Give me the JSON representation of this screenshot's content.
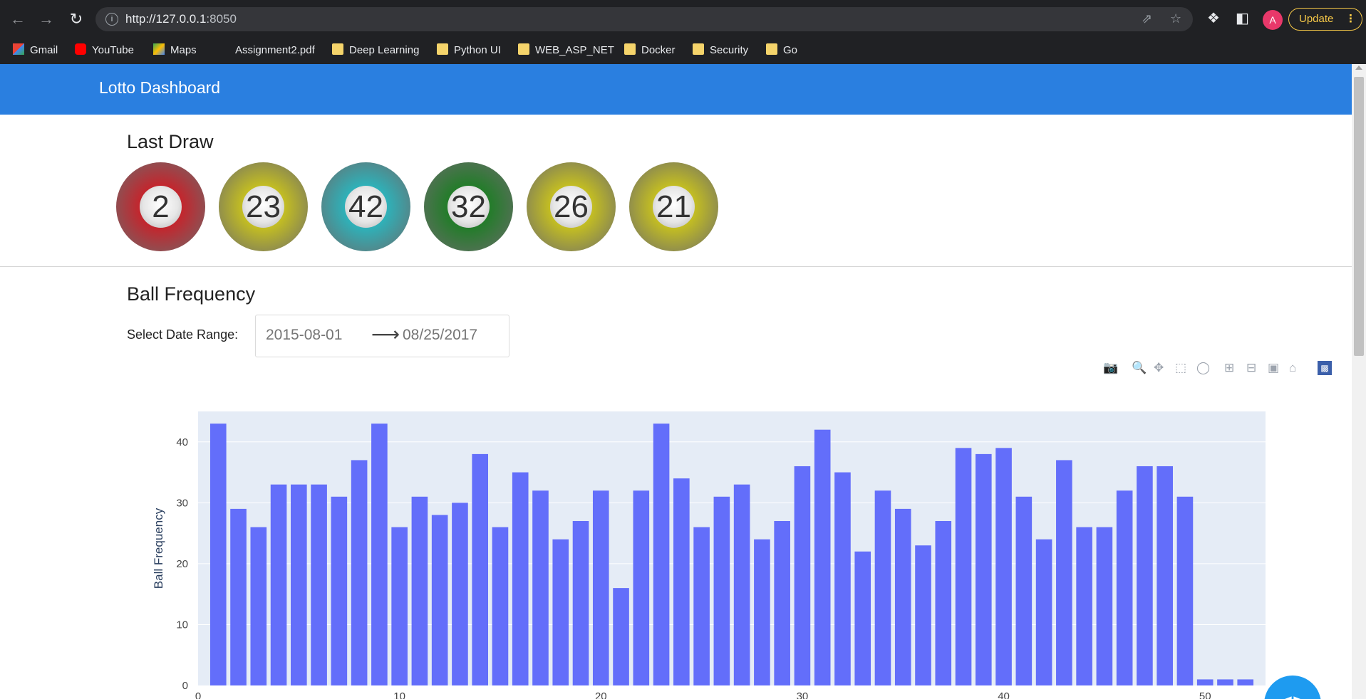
{
  "browser": {
    "url_host": "http://127.0.0.1",
    "url_port": ":8050",
    "avatar_letter": "A",
    "update_label": "Update",
    "bookmarks": [
      "Gmail",
      "YouTube",
      "Maps",
      "Assignment2.pdf",
      "Deep Learning",
      "Python UI",
      "WEB_ASP_NET",
      "Docker",
      "Security",
      "Go"
    ]
  },
  "app": {
    "brand": "Lotto Dashboard",
    "last_draw_title": "Last Draw",
    "balls": [
      {
        "number": "2",
        "color": "#c8222a"
      },
      {
        "number": "23",
        "color": "#c8c21e"
      },
      {
        "number": "42",
        "color": "#2bb5bd"
      },
      {
        "number": "32",
        "color": "#1f7d26"
      },
      {
        "number": "26",
        "color": "#c8c21e"
      },
      {
        "number": "21",
        "color": "#c8c21e"
      }
    ],
    "frequency_title": "Ball Frequency",
    "date_range_label": "Select Date Range:",
    "start_date": "2015-08-01",
    "end_date": "08/25/2017",
    "modebar_icons": [
      "camera-icon",
      "zoom-icon",
      "pan-icon",
      "box-select-icon",
      "lasso-icon",
      "zoom-in-icon",
      "zoom-out-icon",
      "autoscale-icon",
      "reset-axes-icon",
      "plotly-logo-icon"
    ]
  },
  "chart_data": {
    "type": "bar",
    "ylabel": "Ball Frequency",
    "xlabel": "",
    "xlim": [
      0,
      53
    ],
    "ylim": [
      0,
      45
    ],
    "xticks": [
      0,
      10,
      20,
      30,
      40,
      50
    ],
    "yticks": [
      0,
      10,
      20,
      30,
      40
    ],
    "x": [
      1,
      2,
      3,
      4,
      5,
      6,
      7,
      8,
      9,
      10,
      11,
      12,
      13,
      14,
      15,
      16,
      17,
      18,
      19,
      20,
      21,
      22,
      23,
      24,
      25,
      26,
      27,
      28,
      29,
      30,
      31,
      32,
      33,
      34,
      35,
      36,
      37,
      38,
      39,
      40,
      41,
      42,
      43,
      44,
      45,
      46,
      47,
      48,
      49,
      50,
      51,
      52
    ],
    "values": [
      43,
      29,
      26,
      33,
      33,
      33,
      31,
      37,
      43,
      26,
      31,
      28,
      30,
      38,
      26,
      35,
      32,
      24,
      27,
      32,
      16,
      32,
      43,
      34,
      26,
      31,
      33,
      24,
      27,
      36,
      42,
      35,
      22,
      32,
      29,
      23,
      27,
      39,
      38,
      39,
      31,
      24,
      37,
      26,
      26,
      32,
      36,
      36,
      31,
      1,
      1,
      1
    ],
    "bar_color": "#636efa",
    "plot_bg": "#e5ecf6"
  }
}
